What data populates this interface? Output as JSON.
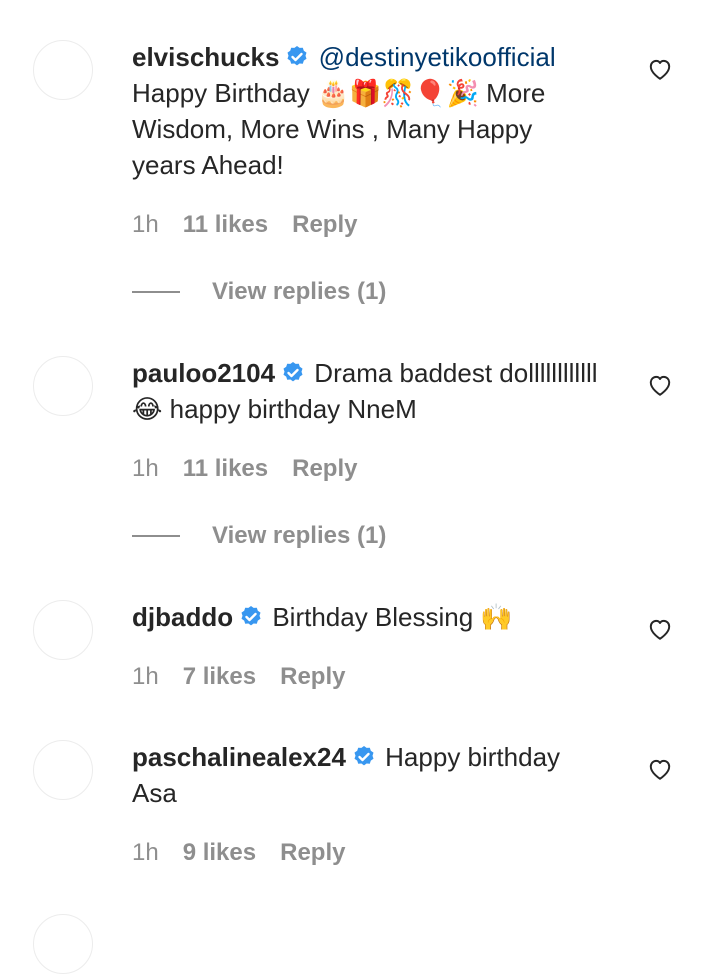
{
  "comments": [
    {
      "username": "elvischucks",
      "mention": "@destinyetikoofficial",
      "text": "Happy Birthday 🎂🎁🎊🎈🎉 More Wisdom, More Wins , Many Happy years Ahead!",
      "time": "1h",
      "likes": "11 likes",
      "reply": "Reply",
      "view_replies": "View replies (1)"
    },
    {
      "username": "pauloo2104",
      "text": "Drama baddest dollllllllllll 😂 happy birthday NneM",
      "time": "1h",
      "likes": "11 likes",
      "reply": "Reply",
      "view_replies": "View replies (1)"
    },
    {
      "username": "djbaddo",
      "text": "Birthday Blessing 🙌",
      "time": "1h",
      "likes": "7 likes",
      "reply": "Reply"
    },
    {
      "username": "paschalinealex24",
      "text": "Happy birthday Asa",
      "time": "1h",
      "likes": "9 likes",
      "reply": "Reply"
    }
  ],
  "icons": {
    "verified": "verified-badge-icon",
    "like": "heart-icon"
  },
  "colors": {
    "verified": "#3897f0",
    "mention": "#00376b",
    "muted": "#8e8e8e",
    "text": "#262626"
  }
}
